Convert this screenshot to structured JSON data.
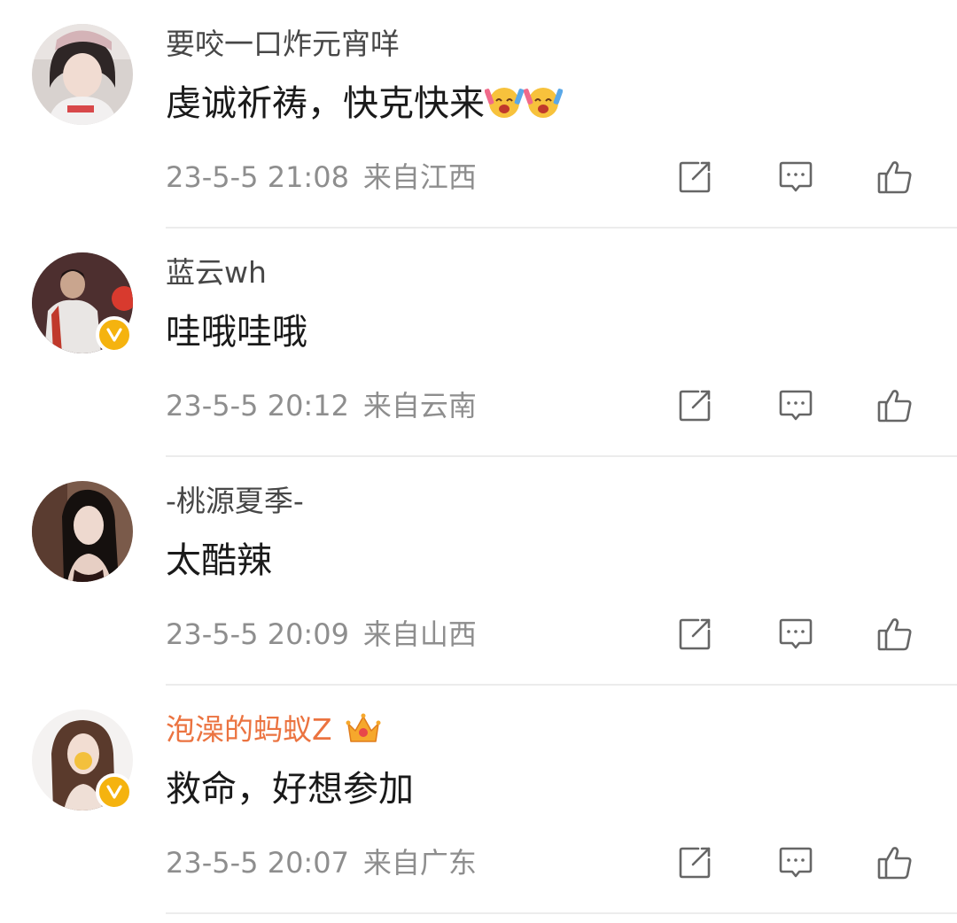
{
  "comments": [
    {
      "user": "要咬一口炸元宵咩",
      "text": "虔诚祈祷，快克快来",
      "emoji": [
        "cheering-face-icon",
        "cheering-face-icon"
      ],
      "time": "23-5-5 21:08",
      "location": "来自江西",
      "verified": false,
      "vip": false
    },
    {
      "user": "蓝云wh",
      "text": "哇哦哇哦",
      "time": "23-5-5 20:12",
      "location": "来自云南",
      "verified": true,
      "vip": false
    },
    {
      "user": "-桃源夏季-",
      "text": "太酷辣",
      "time": "23-5-5 20:09",
      "location": "来自山西",
      "verified": false,
      "vip": false
    },
    {
      "user": "泡澡的蚂蚁Z",
      "text": "救命，好想参加",
      "time": "23-5-5 20:07",
      "location": "来自广东",
      "verified": true,
      "vip": true
    }
  ],
  "colors": {
    "username": "#474747",
    "vip_username": "#eb7340",
    "content": "#1a1a1a",
    "meta": "#8e8e8e",
    "icon": "#666666",
    "verified_badge": "#f5b30f",
    "divider": "#ececec"
  },
  "icons": {
    "share": "share-icon",
    "comment": "comment-icon",
    "like": "thumbs-up-icon",
    "verified": "verified-badge-icon",
    "vip": "crown-icon"
  }
}
